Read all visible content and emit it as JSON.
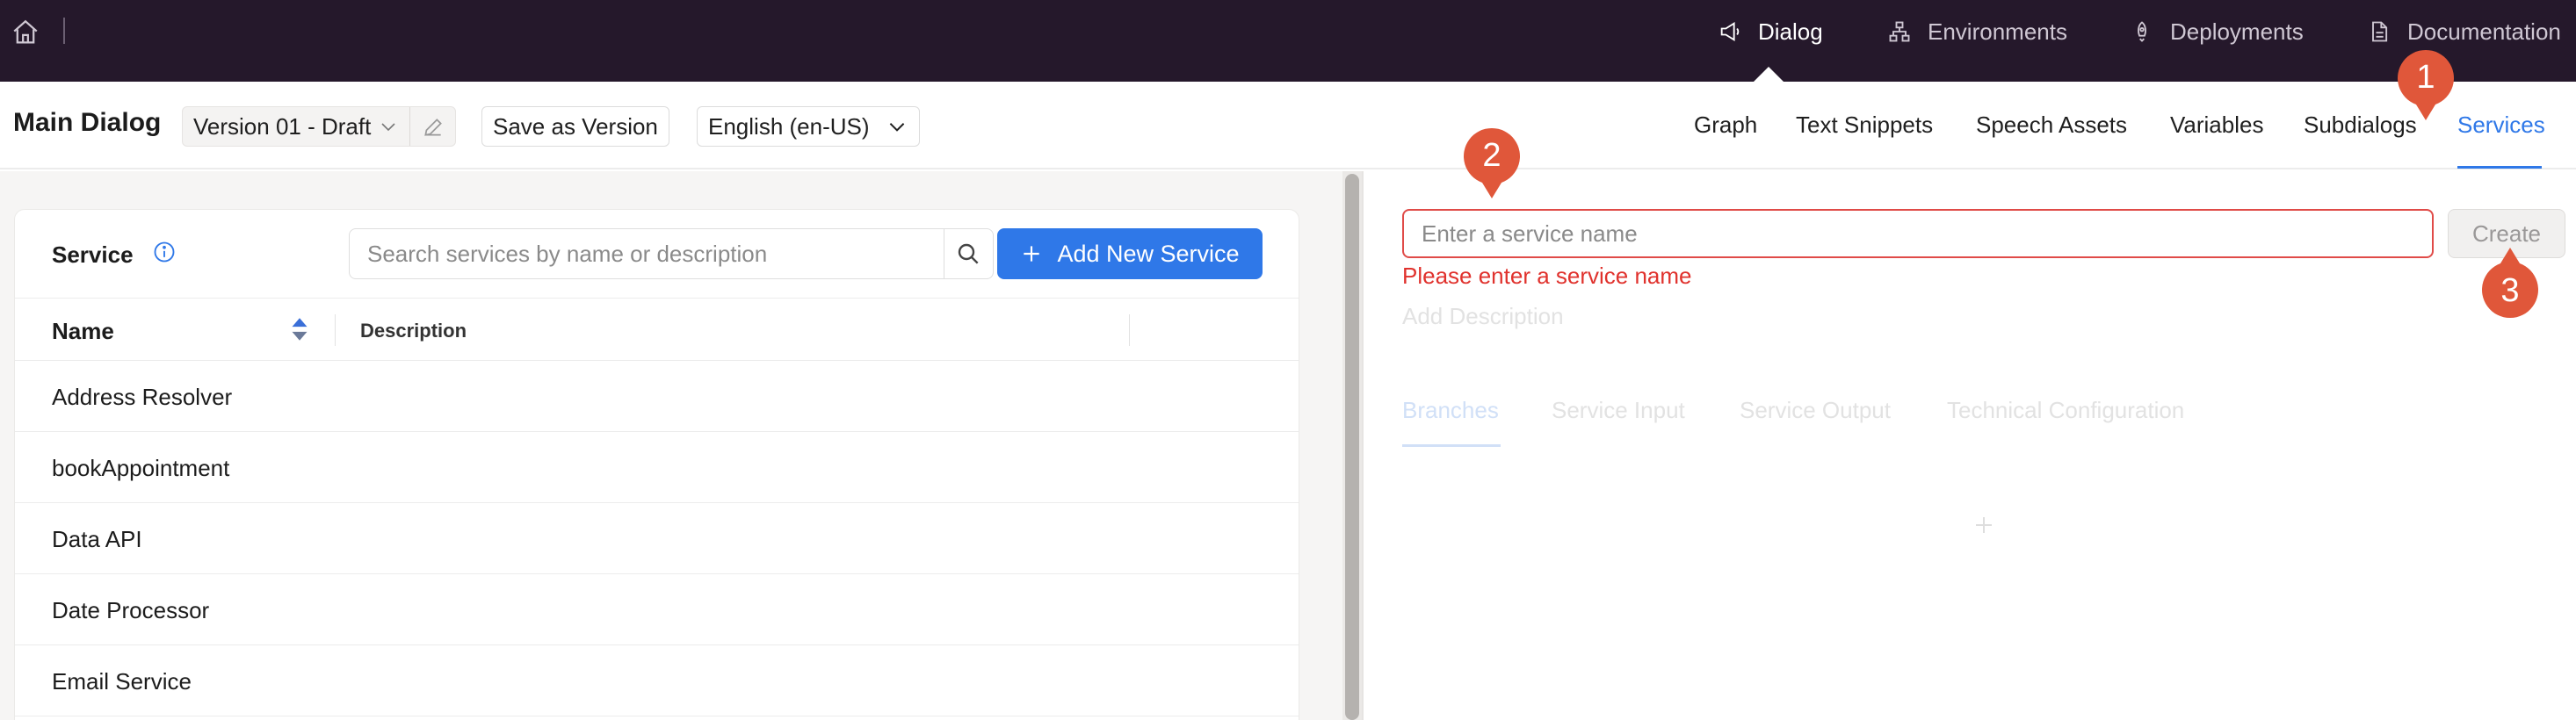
{
  "topnav": {
    "items": [
      {
        "label": "Dialog",
        "icon": "megaphone-icon",
        "active": true
      },
      {
        "label": "Environments",
        "icon": "sitemap-icon",
        "active": false
      },
      {
        "label": "Deployments",
        "icon": "rocket-icon",
        "active": false
      },
      {
        "label": "Documentation",
        "icon": "document-icon",
        "active": false
      }
    ]
  },
  "toolbar": {
    "title": "Main Dialog",
    "version": "Version 01 - Draft",
    "save_version": "Save as Version",
    "language": "English (en-US)",
    "tabs": [
      "Graph",
      "Text Snippets",
      "Speech Assets",
      "Variables",
      "Subdialogs",
      "Services"
    ],
    "active_tab": "Services"
  },
  "services": {
    "title": "Service",
    "search_placeholder": "Search services by name or description",
    "add_button": "Add New Service",
    "columns": {
      "name": "Name",
      "description": "Description"
    },
    "rows": [
      "Address Resolver",
      "bookAppointment",
      "Data API",
      "Date Processor",
      "Email Service"
    ]
  },
  "editor": {
    "name_placeholder": "Enter a service name",
    "create_label": "Create",
    "error": "Please enter a service name",
    "add_description": "Add Description",
    "tabs": [
      "Branches",
      "Service Input",
      "Service Output",
      "Technical Configuration"
    ]
  },
  "markers": [
    "1",
    "2",
    "3"
  ],
  "colors": {
    "nav_bg": "#25182b",
    "accent": "#2f78e8",
    "error": "#e0322d",
    "marker": "#e0573a"
  }
}
